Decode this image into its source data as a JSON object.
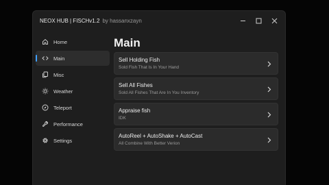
{
  "window": {
    "title": "NEOX HUB | FISCHv1.2",
    "subtitle": "by hassanxzayn"
  },
  "sidebar": {
    "items": [
      {
        "label": "Home",
        "icon": "home-icon",
        "active": false
      },
      {
        "label": "Main",
        "icon": "code-icon",
        "active": true
      },
      {
        "label": "Misc",
        "icon": "copy-icon",
        "active": false
      },
      {
        "label": "Weather",
        "icon": "sun-icon",
        "active": false
      },
      {
        "label": "Teleport",
        "icon": "compass-icon",
        "active": false
      },
      {
        "label": "Performance",
        "icon": "wrench-icon",
        "active": false
      },
      {
        "label": "Settings",
        "icon": "gear-icon",
        "active": false
      }
    ]
  },
  "main": {
    "title": "Main",
    "cards": [
      {
        "title": "Sell Holding Fish",
        "desc": "Sold Fish That Is In Your Hand"
      },
      {
        "title": "Sell All Fishes",
        "desc": "Sold All Fishes That Are In You Inventory"
      },
      {
        "title": "Appraise fish",
        "desc": "IDK"
      },
      {
        "title": "AutoReel + AutoShake + AutoCast",
        "desc": "All Combine With Better Verion"
      }
    ]
  },
  "colors": {
    "background": "#050505",
    "window": "#1e1e1e",
    "card": "#2b2b2b",
    "accent": "#3fa0ff"
  }
}
